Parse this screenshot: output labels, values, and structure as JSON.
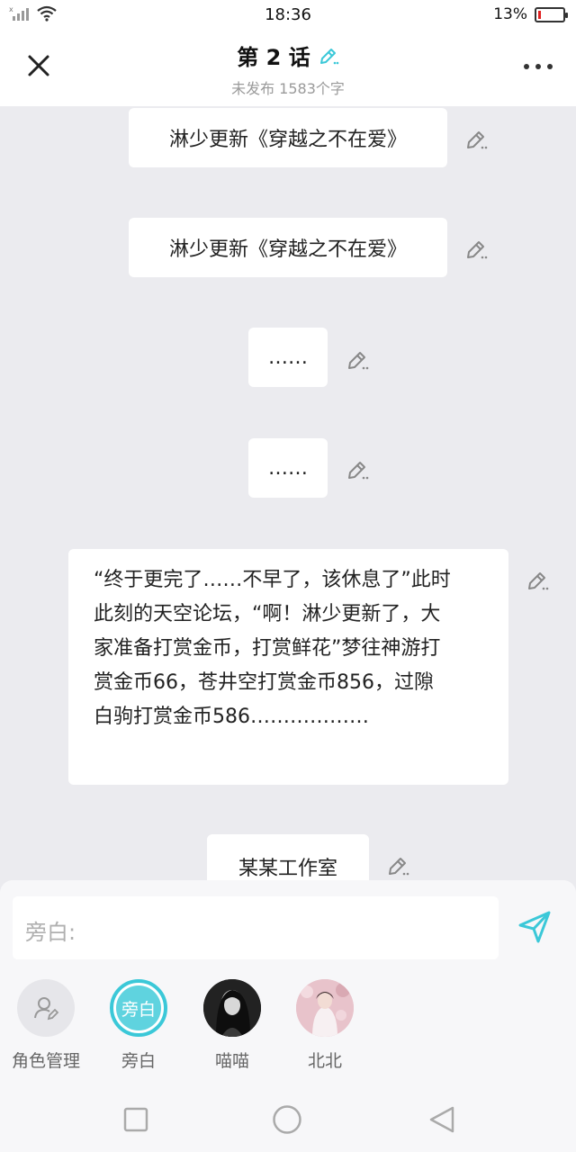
{
  "status_bar": {
    "time": "18:36",
    "battery": "13%",
    "battery_level": 0.13
  },
  "header": {
    "title": "第 2 话",
    "subtitle": "未发布 1583个字"
  },
  "messages": [
    {
      "text": "淋少更新《穿越之不在爱》"
    },
    {
      "text": "淋少更新《穿越之不在爱》"
    },
    {
      "text": "……"
    },
    {
      "text": "……"
    },
    {
      "lines": [
        "“终于更完了……不早了，该休息了”此时",
        "此刻的天空论坛，“啊！淋少更新了，大",
        "家准备打赏金币，打赏鲜花”梦往神游打",
        "赏金币66，苍井空打赏金币856，过隙",
        "白驹打赏金币586………………"
      ]
    },
    {
      "text": "某某工作室"
    }
  ],
  "input": {
    "placeholder": "旁白:"
  },
  "roles": [
    {
      "label": "角色管理",
      "icon": "role-manage-icon"
    },
    {
      "label": "旁白",
      "avatar_text": "旁白",
      "selected": true
    },
    {
      "label": "喵喵",
      "icon": "avatar-photo"
    },
    {
      "label": "北北",
      "icon": "avatar-photo"
    }
  ],
  "colors": {
    "accent": "#3bc8d8",
    "background": "#ebebef"
  }
}
